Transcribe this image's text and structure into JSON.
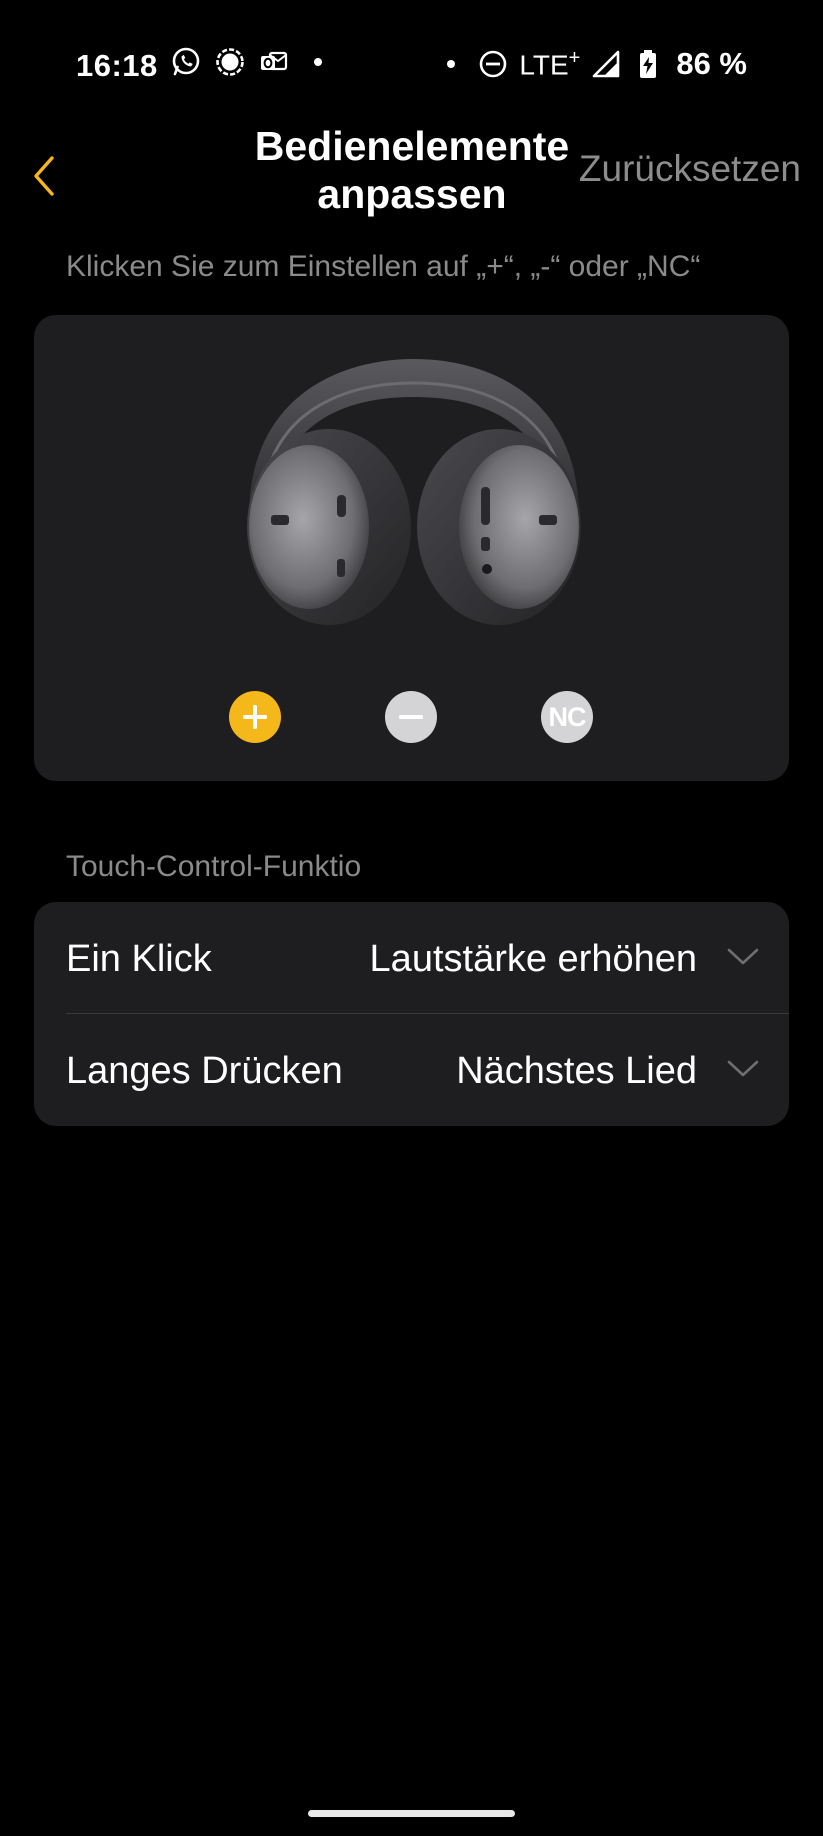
{
  "status_bar": {
    "time": "16:18",
    "network": "LTE",
    "network_suffix": "+",
    "battery": "86 %",
    "left_icons": [
      "whatsapp-icon",
      "signal-messenger-icon",
      "outlook-icon"
    ],
    "right_icons": [
      "do-not-disturb-icon",
      "cell-signal-icon",
      "battery-charging-icon"
    ]
  },
  "header": {
    "title": "Bedienelemente anpassen",
    "reset_label": "Zurücksetzen",
    "accent_color": "#f5b81b"
  },
  "instruction": "Klicken Sie zum Einstellen auf „+“, „-“ oder „NC“",
  "controls": {
    "plus": {
      "selected": true
    },
    "minus": {
      "selected": false
    },
    "nc": {
      "label": "NC",
      "selected": false
    }
  },
  "section_label": "Touch-Control-Funktio",
  "settings": [
    {
      "label": "Ein Klick",
      "value": "Lautstärke erhöhen"
    },
    {
      "label": "Langes Drücken",
      "value": "Nächstes Lied"
    }
  ]
}
